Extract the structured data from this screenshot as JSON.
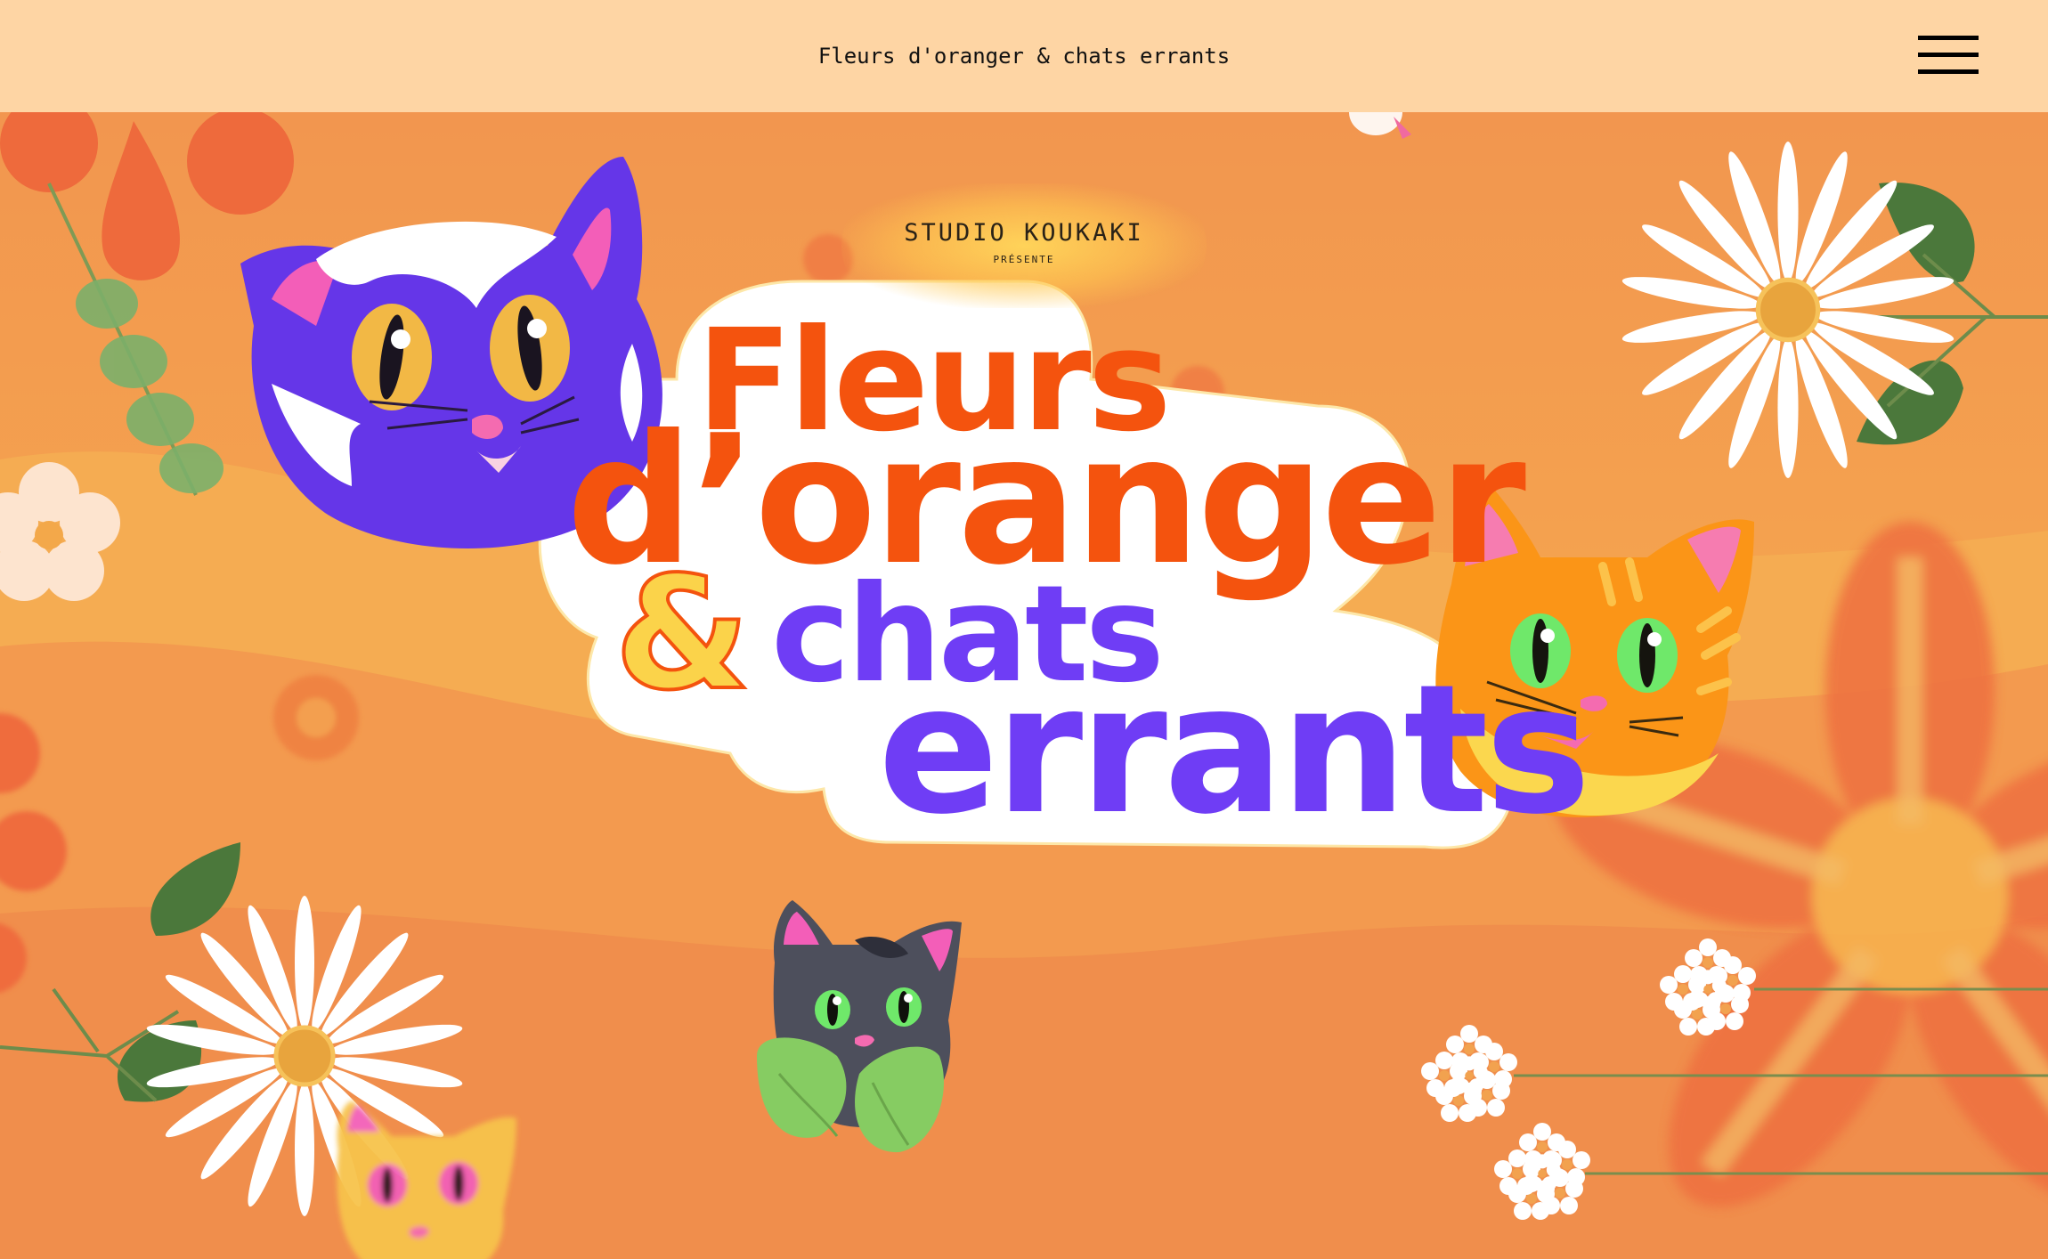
{
  "header": {
    "title": "Fleurs d'oranger & chats errants",
    "menu_icon": "hamburger-menu-icon"
  },
  "hero": {
    "studio_name": "STUDIO KOUKAKI",
    "studio_tagline": "PRÉSENTE",
    "title_lines": [
      "Fleurs",
      "d’oranger",
      "&",
      "chats",
      "errants"
    ]
  },
  "colors": {
    "header_bg": "#fed5a4",
    "hero_bg": "#f2934e",
    "title_orange": "#f4530e",
    "title_purple": "#6f3df5",
    "ampersand_yellow": "#fbd34a"
  },
  "decor": {
    "illustrations": [
      "purple-cat-icon",
      "orange-cat-icon",
      "grey-cat-icon",
      "yellow-cat-icon",
      "daisy-flower-icon",
      "orange-blossom-icon",
      "leaf-icon"
    ]
  }
}
